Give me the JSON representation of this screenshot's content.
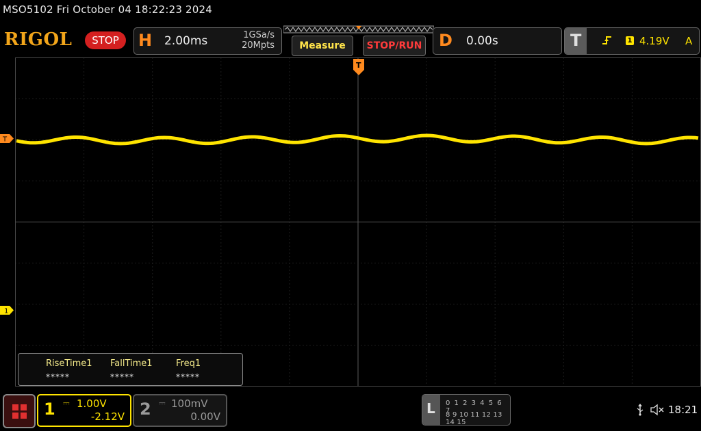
{
  "title": "MSO5102  Fri October 04 18:22:23 2024",
  "brand": "RIGOL",
  "run_state": "STOP",
  "horizontal": {
    "letter": "H",
    "timebase": "2.00ms",
    "sample_rate": "1GSa/s",
    "memory_depth": "20Mpts"
  },
  "buttons": {
    "measure": "Measure",
    "stop_run": "STOP/RUN"
  },
  "delay": {
    "letter": "D",
    "value": "0.00s"
  },
  "trigger": {
    "letter": "T",
    "slope_icon": "rising-edge-icon",
    "source": "1",
    "level": "4.19V",
    "coupling": "A"
  },
  "markers": {
    "trigger_level": "T",
    "trigger_position": "T",
    "channel1": "1"
  },
  "measurements": [
    {
      "label": "RiseTime1",
      "value": "*****"
    },
    {
      "label": "FallTime1",
      "value": "*****"
    },
    {
      "label": "Freq1",
      "value": "*****"
    }
  ],
  "channels": [
    {
      "number": "1",
      "coupling": "⎓",
      "scale": "1.00V",
      "offset": "-2.12V",
      "active": true,
      "color": "#ffe400"
    },
    {
      "number": "2",
      "coupling": "⎓",
      "scale": "100mV",
      "offset": "0.00V",
      "active": false,
      "color": "#9a9a9a"
    }
  ],
  "logic_analyzer": {
    "letter": "L",
    "row1": "0 1 2 3  4 5 6 7",
    "row2": "8 9 10 11 12 13 14 15"
  },
  "status": {
    "usb_icon": "usb-icon",
    "sound_icon": "mute-icon",
    "clock": "18:21"
  },
  "colors": {
    "brand": "#f2a51a",
    "stop": "#d42020",
    "trace": "#ffe400",
    "accent": "#ff8a1e"
  }
}
